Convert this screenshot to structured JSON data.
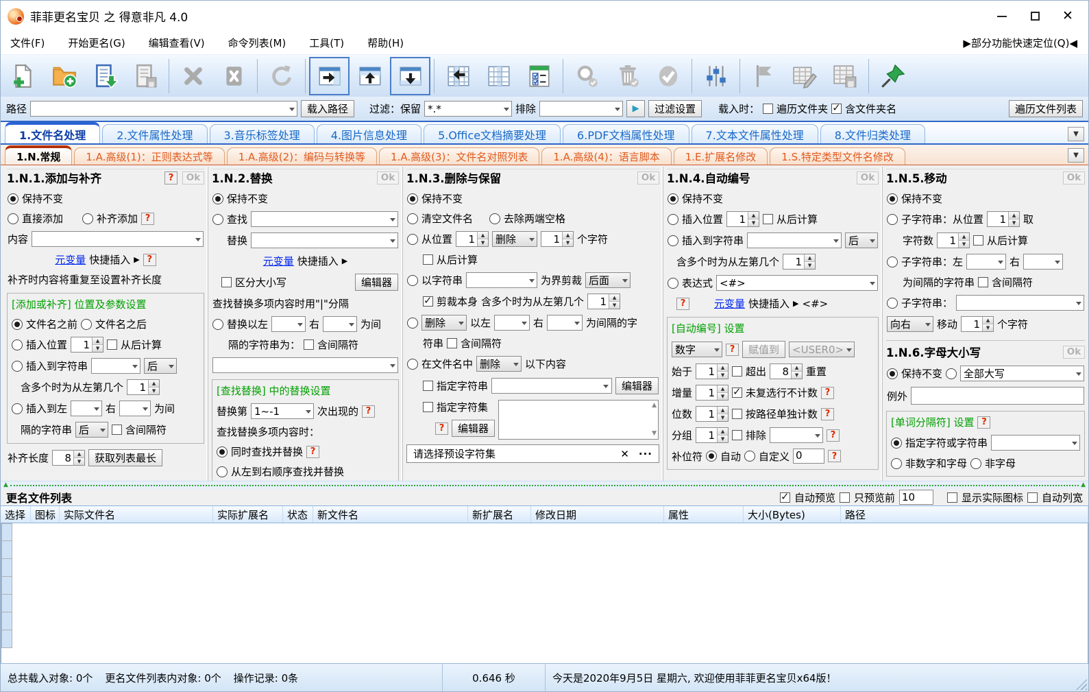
{
  "window": {
    "title": "菲菲更名宝贝 之 得意非凡 4.0"
  },
  "ui": {
    "arrow": "▶",
    "dd": "▼",
    "up": "▲",
    "down": "▼",
    "close": "✕",
    "more": "···"
  },
  "menu": {
    "items": [
      "文件(F)",
      "开始更名(G)",
      "编辑查看(V)",
      "命令列表(M)",
      "工具(T)",
      "帮助(H)"
    ],
    "quick": "▶部分功能快速定位(Q)◀"
  },
  "toolbar": {
    "icon_names": [
      "new-file",
      "open-folder",
      "import-list",
      "save-list",
      "delete",
      "delete-all",
      "refresh",
      "panel-right",
      "panel-up",
      "panel-down",
      "freeze-columns",
      "column-layout",
      "check-options",
      "search",
      "clean",
      "apply",
      "settings",
      "flag",
      "edit-table",
      "export-table",
      "pin"
    ]
  },
  "pathbar": {
    "path_label": "路径",
    "load_path": "载入路径",
    "filter_label": "过滤：保留",
    "filter_value": "*.*",
    "exclude_label": "排除",
    "filter_settings": "过滤设置",
    "load_when": "载入时：",
    "traverse_folder": "遍历文件夹",
    "include_folder": "含文件夹名",
    "traverse_list": "遍历文件列表"
  },
  "main_tabs": [
    "1.文件名处理",
    "2.文件属性处理",
    "3.音乐标签处理",
    "4.图片信息处理",
    "5.Office文档摘要处理",
    "6.PDF文档属性处理",
    "7.文本文件属性处理",
    "8.文件归类处理"
  ],
  "sub_tabs": [
    "1.N.常规",
    "1.A.高级(1)：正则表达式等",
    "1.A.高级(2)：编码与转换等",
    "1.A.高级(3)：文件名对照列表",
    "1.A.高级(4)：语言脚本",
    "1.E.扩展名修改",
    "1.S.特定类型文件名修改"
  ],
  "p1": {
    "title": "1.N.1.添加与补齐",
    "help": "?",
    "ok": "Ok",
    "keep": "保持不变",
    "direct": "直接添加",
    "pad": "补齐添加",
    "content": "内容",
    "var_link": "元变量",
    "quick_insert": "快捷插入",
    "note": "补齐时内容将重复至设置补齐长度",
    "group": "[添加或补齐] 位置及参数设置",
    "before": "文件名之前",
    "after": "文件名之后",
    "insert_pos": "插入位置",
    "v1": "1",
    "from_end": "从后计算",
    "insert_str": "插入到字符串",
    "after_opt": "后",
    "multi": "含多个时为从左第几个",
    "v2": "1",
    "insert_lr": "插入到左",
    "right": "右",
    "as_sep": "为间",
    "sep_str": "隔的字符串",
    "incl_sep": "含间隔符",
    "pad_len": "补齐长度",
    "v8": "8",
    "get_longest": "获取列表最长"
  },
  "p2": {
    "title": "1.N.2.替换",
    "ok": "Ok",
    "keep": "保持不变",
    "find": "查找",
    "replace": "替换",
    "var_link": "元变量",
    "quick_insert": "快捷插入",
    "case": "区分大小写",
    "editor": "编辑器",
    "note": "查找替换多项内容时用\"|\"分隔",
    "rep_lr": "替换以左",
    "right": "右",
    "as_sep": "为间",
    "sep_line": "隔的字符串为：",
    "incl_sep": "含间隔符",
    "group": "[查找替换] 中的替换设置",
    "rep_nth": "替换第",
    "nth_value": "1~-1",
    "occurrence": "次出现的",
    "help": "?",
    "multi_note": "查找替换多项内容时：",
    "same_time": "同时查找并替换",
    "seq": "从左到右顺序查找并替换"
  },
  "p3": {
    "title": "1.N.3.删除与保留",
    "ok": "Ok",
    "keep": "保持不变",
    "clear": "清空文件名",
    "trim": "去除两端空格",
    "from_pos": "从位置",
    "v1": "1",
    "del_opt": "删除",
    "v1b": "1",
    "chars": "个字符",
    "from_end": "从后计算",
    "by_str": "以字符串",
    "cut_at": "为界剪裁",
    "behind": "后面",
    "cut_self": "剪裁本身",
    "multi": "含多个时为从左第几个",
    "v1c": "1",
    "del_opt2": "删除",
    "lr1": "以左",
    "right": "右",
    "sep_text": "为间隔的字",
    "sep_text2": "符串",
    "incl_sep": "含间隔符",
    "in_name": "在文件名中",
    "del_opt3": "删除",
    "following": "以下内容",
    "spec_str": "指定字符串",
    "editor": "编辑器",
    "spec_set": "指定字符集",
    "help": "?",
    "editor2": "编辑器",
    "preset": "请选择预设字符集"
  },
  "p4": {
    "title": "1.N.4.自动编号",
    "ok": "Ok",
    "keep": "保持不变",
    "insert_pos": "插入位置",
    "v1": "1",
    "from_end": "从后计算",
    "insert_str": "插入到字符串",
    "after_opt": "后",
    "multi": "含多个时为从左第几个",
    "v1b": "1",
    "expr": "表达式",
    "expr_value": "<#>",
    "help": "?",
    "var_link": "元变量",
    "quick_insert": "快捷插入",
    "expr_tag": "<#>",
    "group": "[自动编号] 设置",
    "num_type": "数字",
    "assign": "赋值到",
    "assign_target": "<USER0>",
    "start": "始于",
    "v_start": "1",
    "exceed": "超出",
    "v_exceed": "8",
    "reset": "重置",
    "inc": "增量",
    "v_inc": "1",
    "no_count": "未复选行不计数",
    "digits": "位数",
    "v_dig": "1",
    "per_path": "按路径单独计数",
    "group_label": "分组",
    "v_grp": "1",
    "exclude": "排除",
    "pad_char": "补位符",
    "auto": "自动",
    "custom": "自定义",
    "v_custom": "0"
  },
  "p5": {
    "title": "1.N.5.移动",
    "ok": "Ok",
    "keep": "保持不变",
    "sub1": "子字符串：从位置",
    "v1": "1",
    "take": "取",
    "char_count": "字符数",
    "v1b": "1",
    "from_end": "从后计算",
    "sub2": "子字符串：左",
    "right": "右",
    "sep_text": "为间隔的字符串",
    "incl_sep": "含间隔符",
    "sub3": "子字符串：",
    "dir": "向右",
    "move": "移动",
    "v1c": "1",
    "chars": "个字符"
  },
  "p6": {
    "title": "1.N.6.字母大小写",
    "ok": "Ok",
    "keep": "保持不变",
    "case_opt": "全部大写",
    "except": "例外",
    "group": "[单词分隔符] 设置",
    "help": "?",
    "spec": "指定字符或字符串",
    "non_alnum": "非数字和字母",
    "non_alpha": "非字母"
  },
  "list": {
    "title": "更名文件列表",
    "auto_preview": "自动预览",
    "preview_first": "只预览前",
    "preview_count": "10",
    "show_icons": "显示实际图标",
    "auto_width": "自动列宽",
    "columns": [
      "选择",
      "图标",
      "实际文件名",
      "实际扩展名",
      "状态",
      "新文件名",
      "新扩展名",
      "修改日期",
      "属性",
      "大小(Bytes)",
      "路径"
    ]
  },
  "status": {
    "loaded": "总共载入对象: 0个",
    "in_list": "更名文件列表内对象: 0个",
    "records": "操作记录: 0条",
    "time": "0.646 秒",
    "greeting": "今天是2020年9月5日 星期六, 欢迎使用菲菲更名宝贝x64版！"
  },
  "colors": {
    "accent_blue": "#2f66c8",
    "accent_orange": "#e05a1e",
    "green": "#00a000",
    "link_blue": "#0026f0",
    "help_red": "#e22a00"
  }
}
